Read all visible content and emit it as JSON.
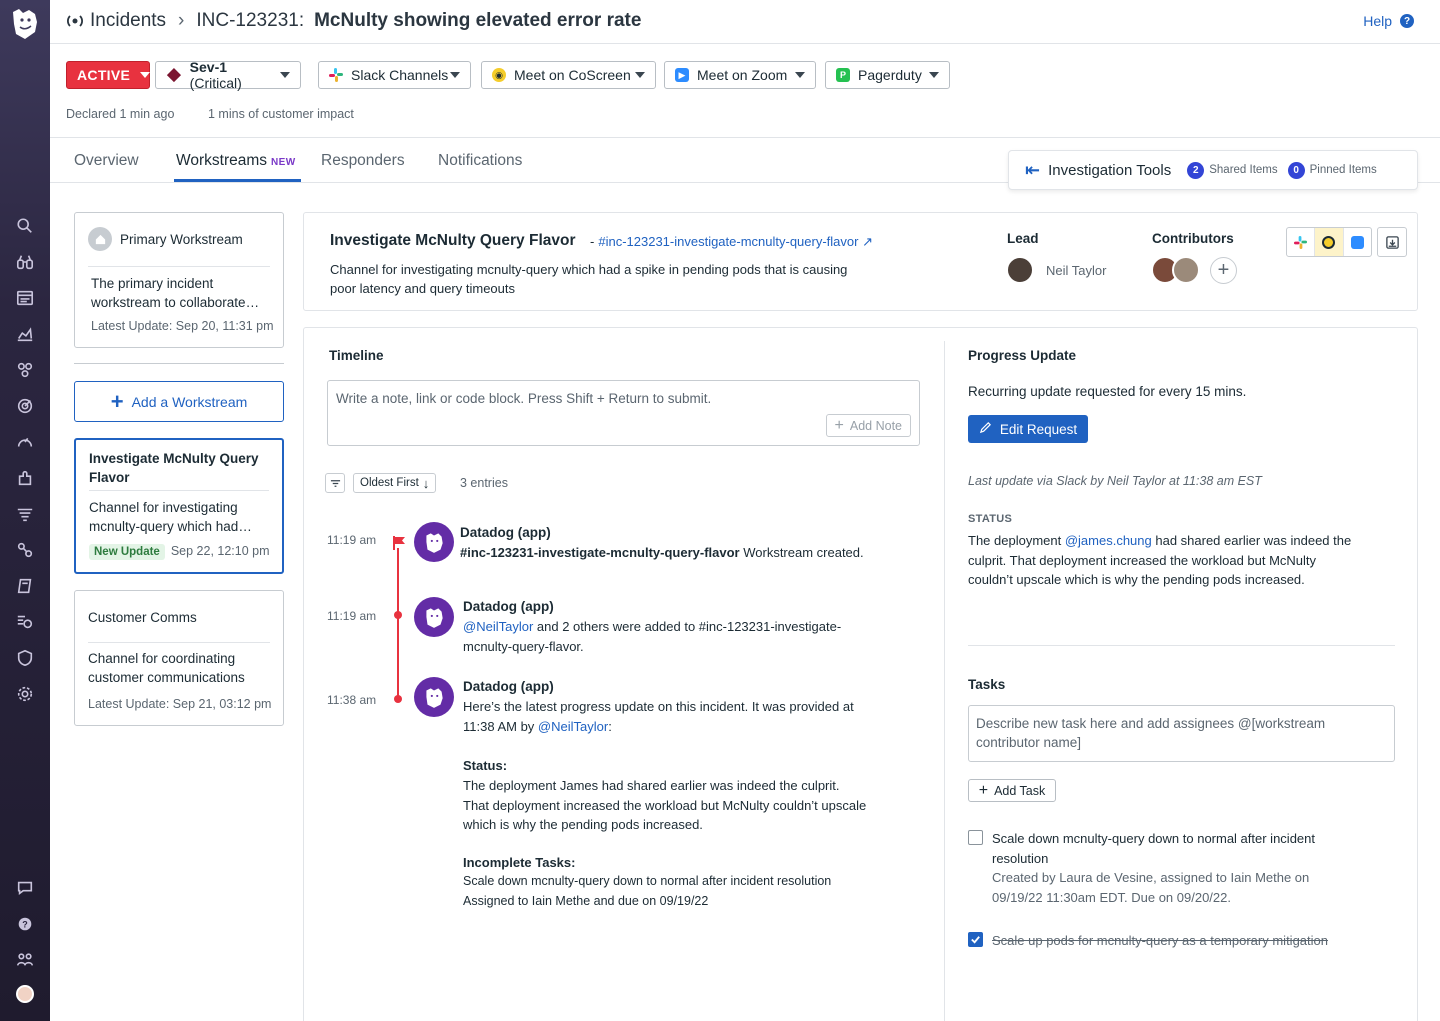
{
  "header": {
    "breadcrumb_root": "Incidents",
    "incident_id": "INC-123231:",
    "incident_title": "McNulty showing elevated error rate",
    "help_label": "Help"
  },
  "toolbar": {
    "status": "ACTIVE",
    "severity_bold": "Sev-1",
    "severity_rest": " (Critical)",
    "slack": "Slack Channels",
    "coscreen": "Meet on CoScreen",
    "zoom": "Meet on Zoom",
    "pagerduty": "Pagerduty"
  },
  "meta": {
    "declared": "Declared 1 min ago",
    "impact": "1 mins of customer impact"
  },
  "tabs": {
    "overview": "Overview",
    "workstreams": "Workstreams",
    "workstreams_badge": "NEW",
    "responders": "Responders",
    "notifications": "Notifications"
  },
  "investigation": {
    "title": "Investigation Tools",
    "shared_count": "2",
    "shared_label": "Shared Items",
    "pinned_count": "0",
    "pinned_label": "Pinned Items"
  },
  "workstreams": {
    "primary": {
      "title": "Primary Workstream",
      "desc": "The primary incident workstream to collaborate…",
      "update": "Latest Update: Sep 20, 11:31 pm"
    },
    "add_label": "Add a Workstream",
    "selected": {
      "title": "Investigate McNulty Query Flavor",
      "desc": "Channel for investigating mcnulty-query which had…",
      "badge": "New Update",
      "update": "Sep 22, 12:10 pm"
    },
    "comms": {
      "title": "Customer Comms",
      "desc": "Channel for coordinating customer communications",
      "update": "Latest Update: Sep 21, 03:12 pm"
    }
  },
  "detail": {
    "title": "Investigate McNulty Query Flavor",
    "dash": "-",
    "channel": "#inc-123231-investigate-mcnulty-query-flavor",
    "desc": "Channel for investigating mcnulty-query which had a spike in pending pods that is causing poor latency and query timeouts",
    "lead_label": "Lead",
    "lead_name": "Neil Taylor",
    "contributors_label": "Contributors"
  },
  "timeline": {
    "heading": "Timeline",
    "placeholder": "Write a note, link or code block. Press Shift + Return to submit.",
    "add_note": "Add Note",
    "sort": "Oldest First",
    "entries": "3 entries",
    "events": [
      {
        "time": "11:19 am",
        "author": "Datadog (app)",
        "channel": "#inc-123231-investigate-mcnulty-query-flavor",
        "text": " Workstream created."
      },
      {
        "time": "11:19 am",
        "author": "Datadog (app)",
        "mention": "@NeilTaylor",
        "text": " and 2 others were added to #inc-123231-investigate-mcnulty-query-flavor."
      },
      {
        "time": "11:38 am",
        "author": "Datadog (app)",
        "intro": "Here’s the latest progress update on this incident. It was provided at 11:38 AM by ",
        "mention": "@NeilTaylor",
        "colon": ":",
        "status_label": "Status:",
        "status_text": "The deployment James had shared earlier was indeed the culprit. That deployment increased the workload but McNulty couldn’t upscale which is why the pending pods increased.",
        "tasks_label": "Incomplete Tasks:",
        "tasks_text_1": "Scale down mcnulty-query down to normal after incident resolution",
        "tasks_text_2": "Assigned to Iain Methe and due on 09/19/22"
      }
    ]
  },
  "progress": {
    "heading": "Progress Update",
    "recurring": "Recurring update requested for every 15 mins.",
    "edit_label": "Edit Request",
    "last_update": "Last update via Slack by Neil Taylor at 11:38 am EST",
    "status_label": "STATUS",
    "status_pre": "The deployment ",
    "status_mention": "@james.chung",
    "status_post": " had shared earlier was indeed the culprit. That deployment increased the workload but McNulty couldn’t upscale which is why the pending pods increased."
  },
  "tasks": {
    "heading": "Tasks",
    "placeholder": "Describe new task here and add assignees @[workstream contributor name]",
    "add_label": "Add Task",
    "items": [
      {
        "title": "Scale down mcnulty-query down to normal after incident resolution",
        "meta": "Created by Laura de Vesine, assigned to Iain Methe on 09/19/22 11:30am EDT. Due on 09/20/22.",
        "done": false
      },
      {
        "title": "Scale up pods for mcnulty-query as a temporary mitigation",
        "done": true
      }
    ]
  },
  "colors": {
    "accent": "#2062c1",
    "danger": "#e8323f",
    "datadog": "#632ca6"
  }
}
